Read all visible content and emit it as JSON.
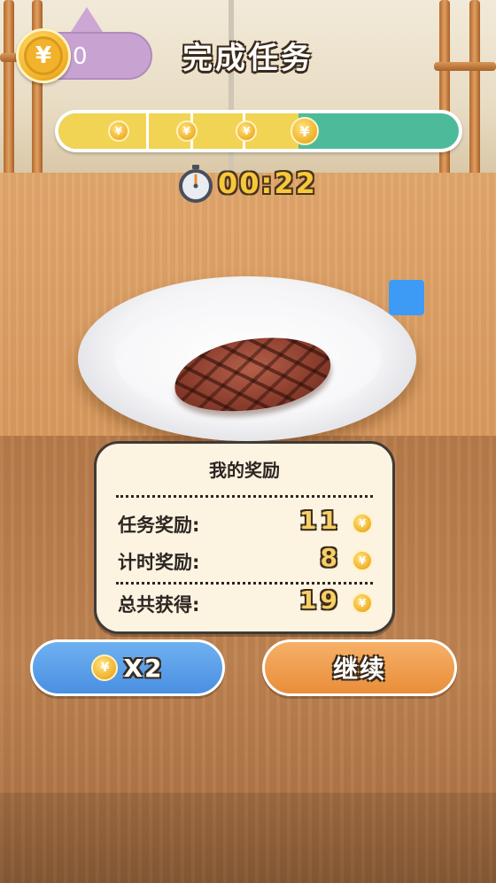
{
  "hud": {
    "coin_count": "0",
    "title": "完成任务",
    "coin_symbol": "¥",
    "progress_fraction": 0.6,
    "timer": "00:22"
  },
  "reward_panel": {
    "title": "我的奖励",
    "rows": [
      {
        "label": "任务奖励:",
        "value": "11"
      },
      {
        "label": "计时奖励:",
        "value": "8"
      },
      {
        "label": "总共获得:",
        "value": "19"
      }
    ]
  },
  "buttons": {
    "double_label": "X2",
    "continue_label": "继续"
  },
  "icons": {
    "coin": "yen-coin-icon",
    "timer": "stopwatch-icon"
  },
  "colors": {
    "progress_fill": "#f2d454",
    "progress_track": "#4dbb9a",
    "double_button": "#4a90e2",
    "continue_button": "#e98e3a"
  }
}
